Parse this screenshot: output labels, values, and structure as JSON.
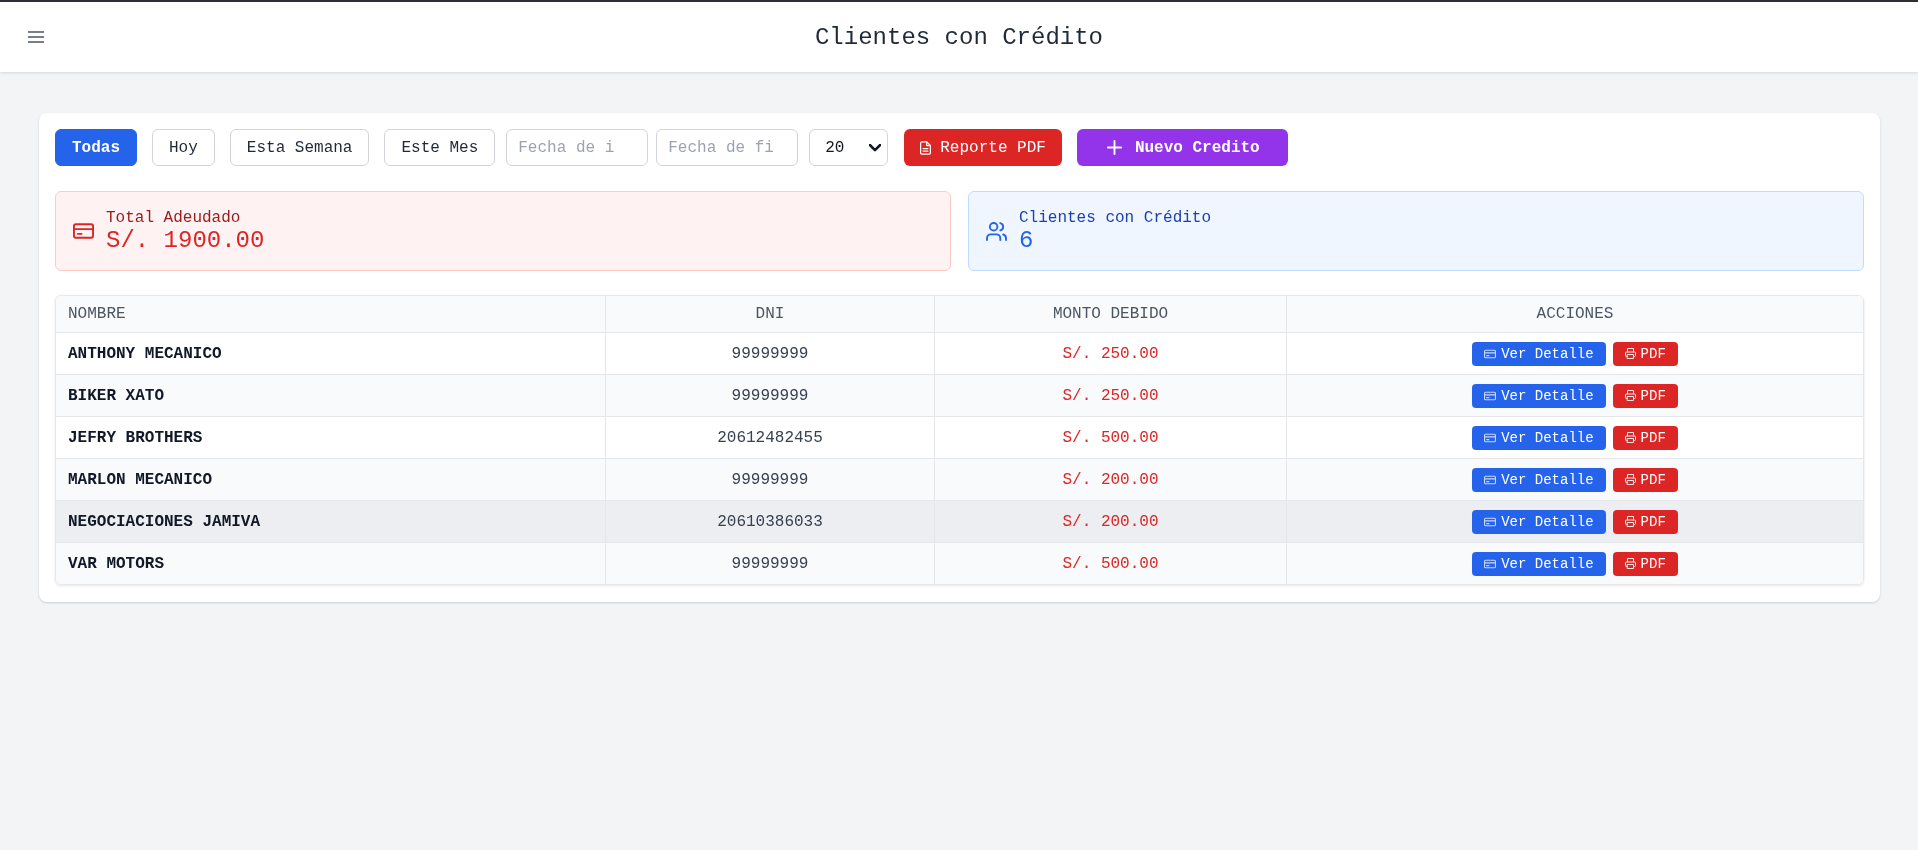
{
  "header": {
    "title": "Clientes con Crédito"
  },
  "filters": [
    {
      "label": "Todas",
      "selected": true
    },
    {
      "label": "Hoy",
      "selected": false
    },
    {
      "label": "Esta Semana",
      "selected": false
    },
    {
      "label": "Este Mes",
      "selected": false
    }
  ],
  "date_inputs": [
    {
      "placeholder": "Fecha de i"
    },
    {
      "placeholder": "Fecha de fi"
    }
  ],
  "page_size": {
    "value": "20"
  },
  "actions": [
    {
      "label": "Reporte PDF",
      "kind": "report"
    },
    {
      "label": "Nuevo Credito",
      "kind": "new"
    }
  ],
  "summary": [
    {
      "kind": "debt",
      "label": "Total Adeudado",
      "value": "S/. 1900.00"
    },
    {
      "kind": "clients",
      "label": "Clientes con Crédito",
      "value": "6"
    }
  ],
  "table": {
    "columns": [
      "NOMBRE",
      "DNI",
      "MONTO DEBIDO",
      "ACCIONES"
    ],
    "rows": [
      {
        "name": "ANTHONY MECANICO",
        "dni": "99999999",
        "amount": "S/. 250.00",
        "hovered": false,
        "buttons": [
          {
            "label": "Ver Detalle",
            "kind": "detail"
          },
          {
            "label": "PDF",
            "kind": "pdf"
          }
        ]
      },
      {
        "name": "BIKER XATO",
        "dni": "99999999",
        "amount": "S/. 250.00",
        "hovered": false,
        "buttons": [
          {
            "label": "Ver Detalle",
            "kind": "detail"
          },
          {
            "label": "PDF",
            "kind": "pdf"
          }
        ]
      },
      {
        "name": "JEFRY BROTHERS",
        "dni": "20612482455",
        "amount": "S/. 500.00",
        "hovered": false,
        "buttons": [
          {
            "label": "Ver Detalle",
            "kind": "detail"
          },
          {
            "label": "PDF",
            "kind": "pdf"
          }
        ]
      },
      {
        "name": "MARLON MECANICO",
        "dni": "99999999",
        "amount": "S/. 200.00",
        "hovered": false,
        "buttons": [
          {
            "label": "Ver Detalle",
            "kind": "detail"
          },
          {
            "label": "PDF",
            "kind": "pdf"
          }
        ]
      },
      {
        "name": "NEGOCIACIONES JAMIVA",
        "dni": "20610386033",
        "amount": "S/. 200.00",
        "hovered": true,
        "buttons": [
          {
            "label": "Ver Detalle",
            "kind": "detail"
          },
          {
            "label": "PDF",
            "kind": "pdf"
          }
        ]
      },
      {
        "name": "VAR MOTORS",
        "dni": "99999999",
        "amount": "S/. 500.00",
        "hovered": false,
        "buttons": [
          {
            "label": "Ver Detalle",
            "kind": "detail"
          },
          {
            "label": "PDF",
            "kind": "pdf"
          }
        ]
      }
    ]
  }
}
